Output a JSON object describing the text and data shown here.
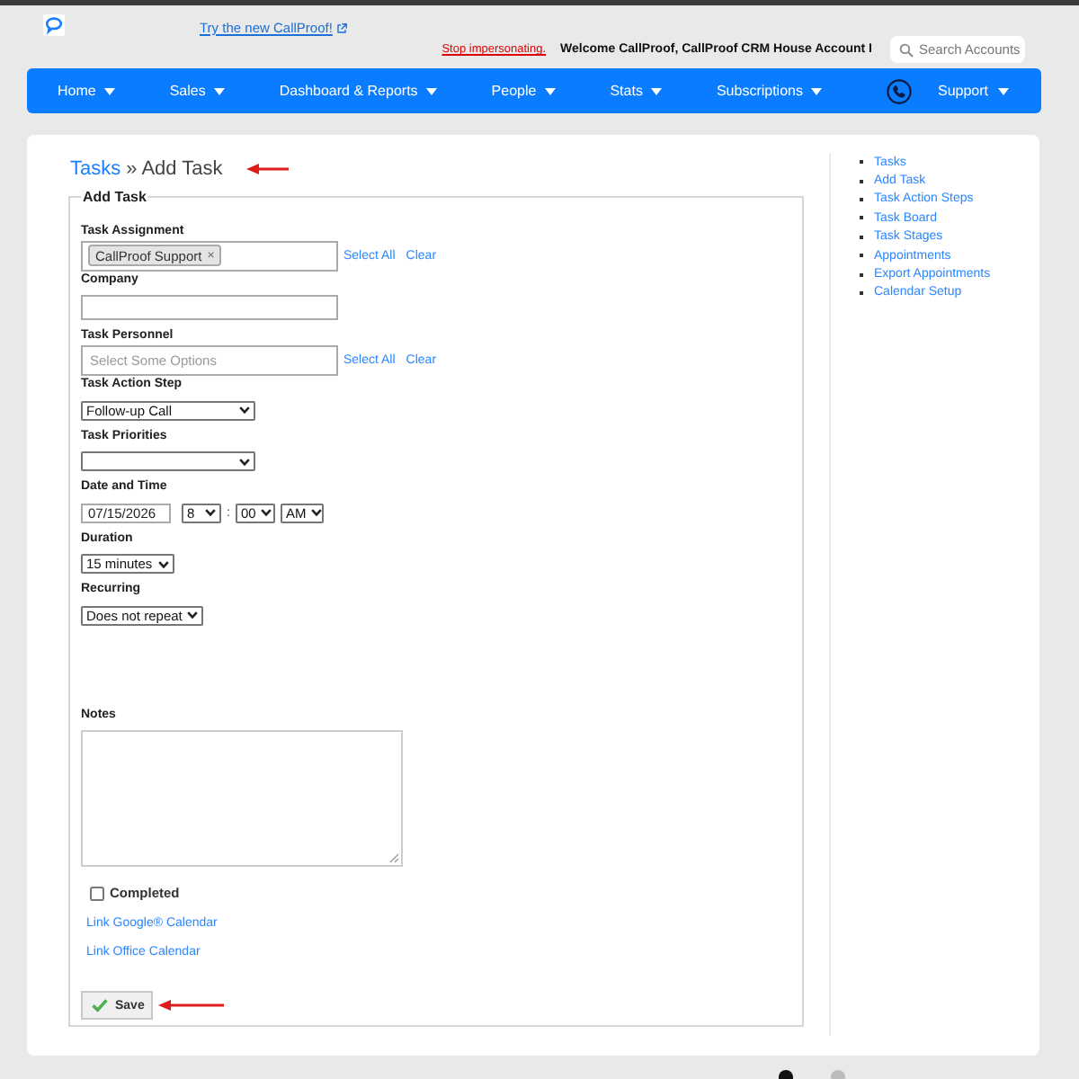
{
  "header": {
    "promo_link": "Try the new CallProof!",
    "stop_link": "Stop impersonating.",
    "welcome": "Welcome CallProof, CallProof CRM House Account I",
    "search": {
      "placeholder": "Search Accounts"
    }
  },
  "nav": [
    {
      "kind": "menu",
      "label": "Home"
    },
    {
      "kind": "menu",
      "label": "Sales"
    },
    {
      "kind": "menu",
      "label": "Dashboard & Reports"
    },
    {
      "kind": "menu",
      "label": "People"
    },
    {
      "kind": "menu",
      "label": "Stats"
    },
    {
      "kind": "menu",
      "label": "Subscriptions"
    },
    {
      "kind": "phone"
    },
    {
      "kind": "menu",
      "label": "Support"
    }
  ],
  "breadcrumb": {
    "link": "Tasks",
    "separator": "»",
    "current": "Add Task"
  },
  "form": {
    "legend": "Add Task",
    "fields": [
      {
        "kind": "multiselect",
        "label": "Task Assignment",
        "tags": [
          {
            "label": "CallProof Support",
            "remove": "×"
          }
        ],
        "actions": [
          "Select All",
          "Clear"
        ]
      },
      {
        "kind": "text",
        "label": "Company"
      },
      {
        "kind": "multiselect",
        "label": "Task Personnel",
        "placeholder": "Select Some Options",
        "actions": [
          "Select All",
          "Clear"
        ]
      },
      {
        "kind": "select",
        "label": "Task Action Step",
        "value": "Follow-up Call"
      },
      {
        "kind": "select",
        "label": "Task Priorities"
      },
      {
        "kind": "datetime",
        "label": "Date and Time",
        "date": "07/15/2026",
        "hour": "8",
        "separator": ":",
        "minute": "00",
        "period": "AM"
      },
      {
        "kind": "select",
        "label": "Duration",
        "value": "15 minutes"
      },
      {
        "kind": "select",
        "label": "Recurring",
        "value": "Does not repeat"
      },
      {
        "kind": "textarea",
        "label": "Notes"
      },
      {
        "kind": "checkbox",
        "label": "Completed",
        "checked": false
      },
      {
        "kind": "link",
        "label": "Link Google® Calendar"
      },
      {
        "kind": "link",
        "label": "Link Office Calendar"
      }
    ],
    "save": "Save"
  },
  "sidebar": {
    "links": [
      "Tasks",
      "Add Task",
      "Task Action Steps",
      "Task Board",
      "Task Stages",
      "Appointments",
      "Export Appointments",
      "Calendar Setup"
    ]
  }
}
